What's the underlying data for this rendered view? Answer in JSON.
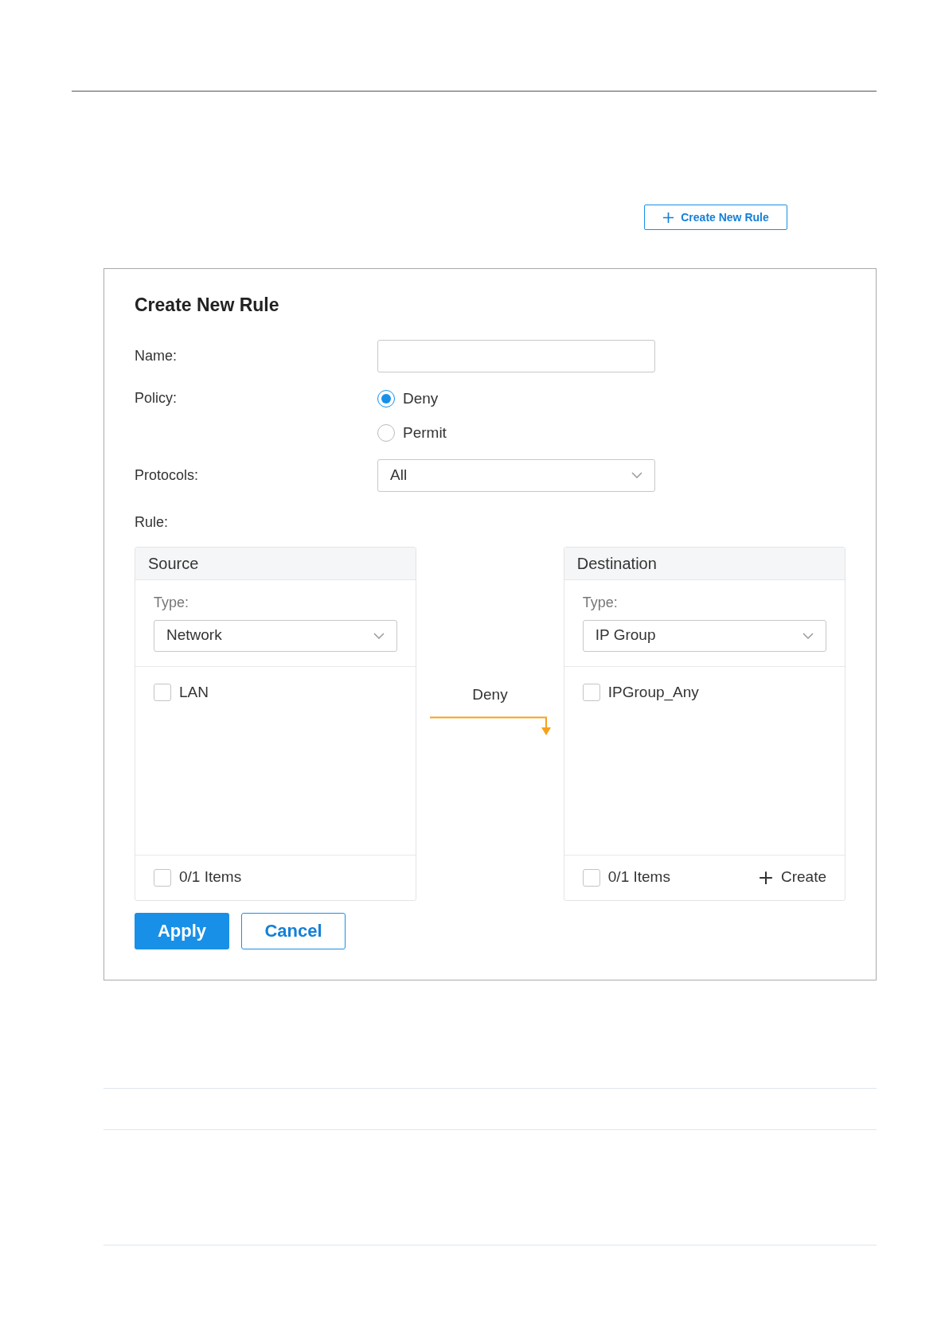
{
  "toolbar": {
    "create_button": "Create New Rule"
  },
  "dialog": {
    "title": "Create New Rule",
    "name_field": {
      "label": "Name:"
    },
    "policy": {
      "label": "Policy:",
      "options": [
        {
          "label": "Deny",
          "selected": true
        },
        {
          "label": "Permit",
          "selected": false
        }
      ]
    },
    "protocols": {
      "label": "Protocols:",
      "value": "All"
    },
    "rule_label": "Rule:",
    "source": {
      "title": "Source",
      "type_label": "Type:",
      "type_value": "Network",
      "items": [
        {
          "label": "LAN",
          "checked": false
        }
      ],
      "footer": {
        "label": "0/1 Items",
        "checked": false
      }
    },
    "arrow_label": "Deny",
    "destination": {
      "title": "Destination",
      "type_label": "Type:",
      "type_value": "IP Group",
      "items": [
        {
          "label": "IPGroup_Any",
          "checked": false
        }
      ],
      "footer": {
        "label": "0/1 Items",
        "checked": false
      },
      "create": "Create"
    },
    "buttons": {
      "apply": "Apply",
      "cancel": "Cancel"
    }
  }
}
